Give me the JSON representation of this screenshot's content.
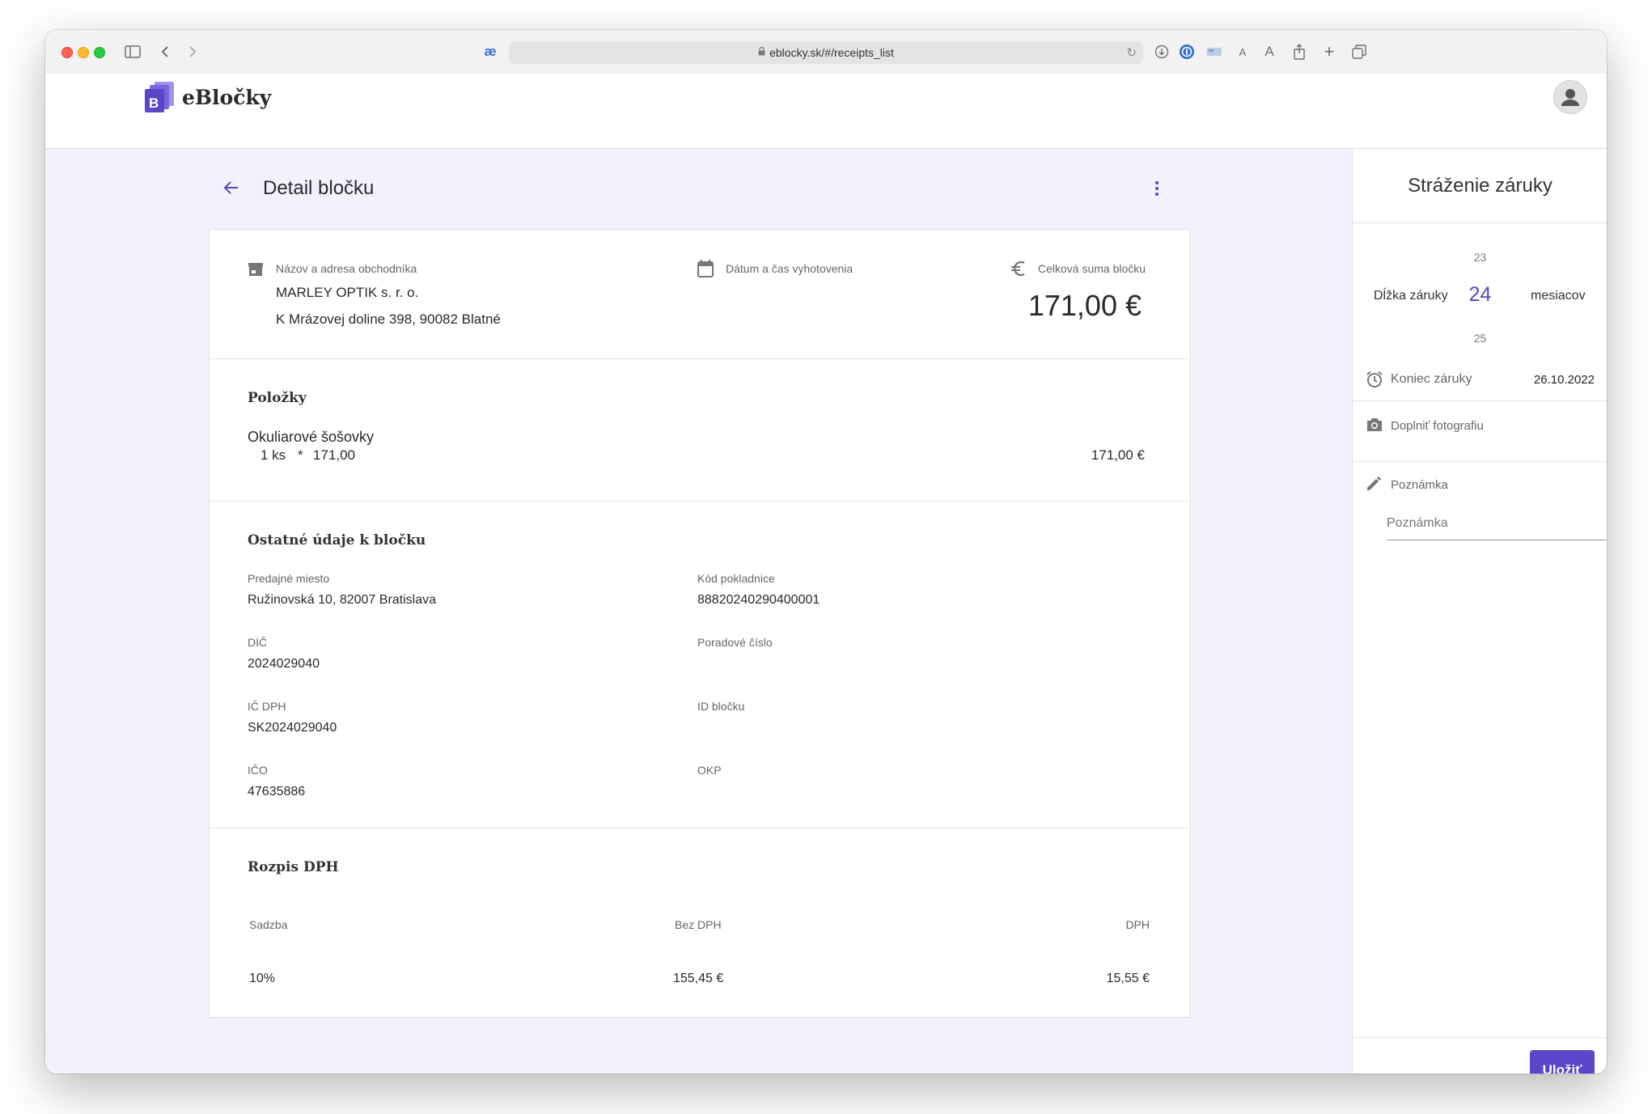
{
  "browser": {
    "url": "eblocky.sk/#/receipts_list"
  },
  "app": {
    "name": "eBločky",
    "logo_letter": "B"
  },
  "page": {
    "title": "Detail bločku"
  },
  "receipt": {
    "merchant_label": "Názov a adresa obchodníka",
    "merchant_name": "MARLEY OPTIK s. r. o.",
    "merchant_address": "K Mrázovej doline 398, 90082 Blatné",
    "date_label": "Dátum a čas vyhotovenia",
    "total_label": "Celková suma bločku",
    "total_value": "171,00 €"
  },
  "items": {
    "title": "Položky",
    "list": [
      {
        "name": "Okuliarové šošovky",
        "qty": "1 ks",
        "times": "*",
        "unit_price": "171,00",
        "total": "171,00 €"
      }
    ]
  },
  "other": {
    "title": "Ostatné údaje k bločku",
    "fields": [
      {
        "label": "Predajné miesto",
        "value": "Ružinovská 10, 82007 Bratislava"
      },
      {
        "label": "Kód pokladnice",
        "value": "88820240290400001"
      },
      {
        "label": "DIČ",
        "value": "2024029040"
      },
      {
        "label": "Poradové číslo",
        "value": ""
      },
      {
        "label": "IČ DPH",
        "value": "SK2024029040"
      },
      {
        "label": "ID bločku",
        "value": ""
      },
      {
        "label": "IČO",
        "value": "47635886"
      },
      {
        "label": "OKP",
        "value": ""
      }
    ]
  },
  "vat": {
    "title": "Rozpis DPH",
    "headers": {
      "rate": "Sadzba",
      "net": "Bez DPH",
      "vat": "DPH"
    },
    "rows": [
      {
        "rate": "10%",
        "net": "155,45 €",
        "vat": "15,55 €"
      }
    ]
  },
  "warranty": {
    "title": "Stráženie záruky",
    "length_label": "Dĺžka záruky",
    "picker_prev": "23",
    "picker_value": "24",
    "picker_next": "25",
    "unit": "mesiacov",
    "end_label": "Koniec záruky",
    "end_date": "26.10.2022",
    "photo_label": "Doplniť fotografiu",
    "note_label": "Poznámka",
    "note_placeholder": "Poznámka",
    "save_label": "Uložiť"
  },
  "colors": {
    "accent": "#5b45c8",
    "background": "#f2f1fd"
  }
}
